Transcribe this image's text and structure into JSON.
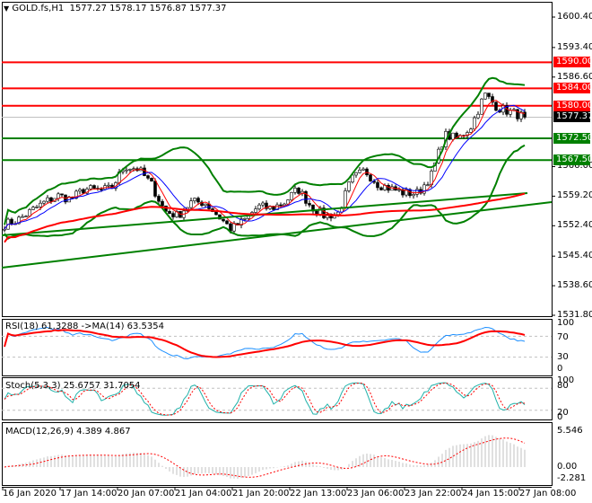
{
  "header": {
    "symbol": "GOLD.fs,H1",
    "ohlc": "1577.27 1578.17 1576.87 1577.37",
    "menu_icon": "triangle-down-icon"
  },
  "price_axis": [
    "1600.40",
    "1593.40",
    "1586.60",
    "1566.00",
    "1559.20",
    "1552.40",
    "1545.40",
    "1538.60",
    "1531.80"
  ],
  "levels": [
    {
      "label": "1590.00",
      "price": 1590.0,
      "color": "#ff0000"
    },
    {
      "label": "1584.00",
      "price": 1584.0,
      "color": "#ff0000"
    },
    {
      "label": "1580.00",
      "price": 1580.0,
      "color": "#ff0000"
    },
    {
      "label": "1572.50",
      "price": 1572.5,
      "color": "#008000"
    },
    {
      "label": "1567.50",
      "price": 1567.5,
      "color": "#008000"
    }
  ],
  "current_price": {
    "label": "1577.37",
    "price": 1577.37
  },
  "rsi": {
    "label": "RSI(18) 61.3288  ->MA(14) 63.5354",
    "axis": [
      "100",
      "70",
      "30",
      "0"
    ]
  },
  "stoch": {
    "label": "Stoch(5,3,3) 25.6757 31.7054",
    "axis": [
      "100",
      "80",
      "20",
      "0"
    ]
  },
  "macd": {
    "label": "MACD(12,26,9) 4.389 4.867",
    "axis": [
      "5.546",
      "0.00",
      "-2.281"
    ]
  },
  "time_axis": [
    "16 Jan 2020",
    "17 Jan 14:00",
    "20 Jan 07:00",
    "21 Jan 04:00",
    "21 Jan 20:00",
    "22 Jan 13:00",
    "23 Jan 06:00",
    "23 Jan 22:00",
    "24 Jan 15:00",
    "27 Jan 08:00"
  ],
  "chart_data": {
    "type": "candlestick",
    "approx_close_path": [
      1552.7,
      1553.7,
      1555.8,
      1557.8,
      1559.3,
      1558.5,
      1560.9,
      1560.5,
      1560.9,
      1566.1,
      1565.5,
      1562.0,
      1555.8,
      1554.7,
      1557.8,
      1557.8,
      1554.7,
      1551.6,
      1553.7,
      1556.8,
      1556.4,
      1557.8,
      1560.9,
      1556.8,
      1554.7,
      1555.2,
      1563.0,
      1565.1,
      1562.0,
      1560.9,
      1559.9,
      1559.9,
      1564.0,
      1573.3,
      1572.3,
      1575.4,
      1582.6,
      1579.5,
      1578.5,
      1577.4
    ],
    "ylim": [
      1531.8,
      1600.4
    ]
  }
}
